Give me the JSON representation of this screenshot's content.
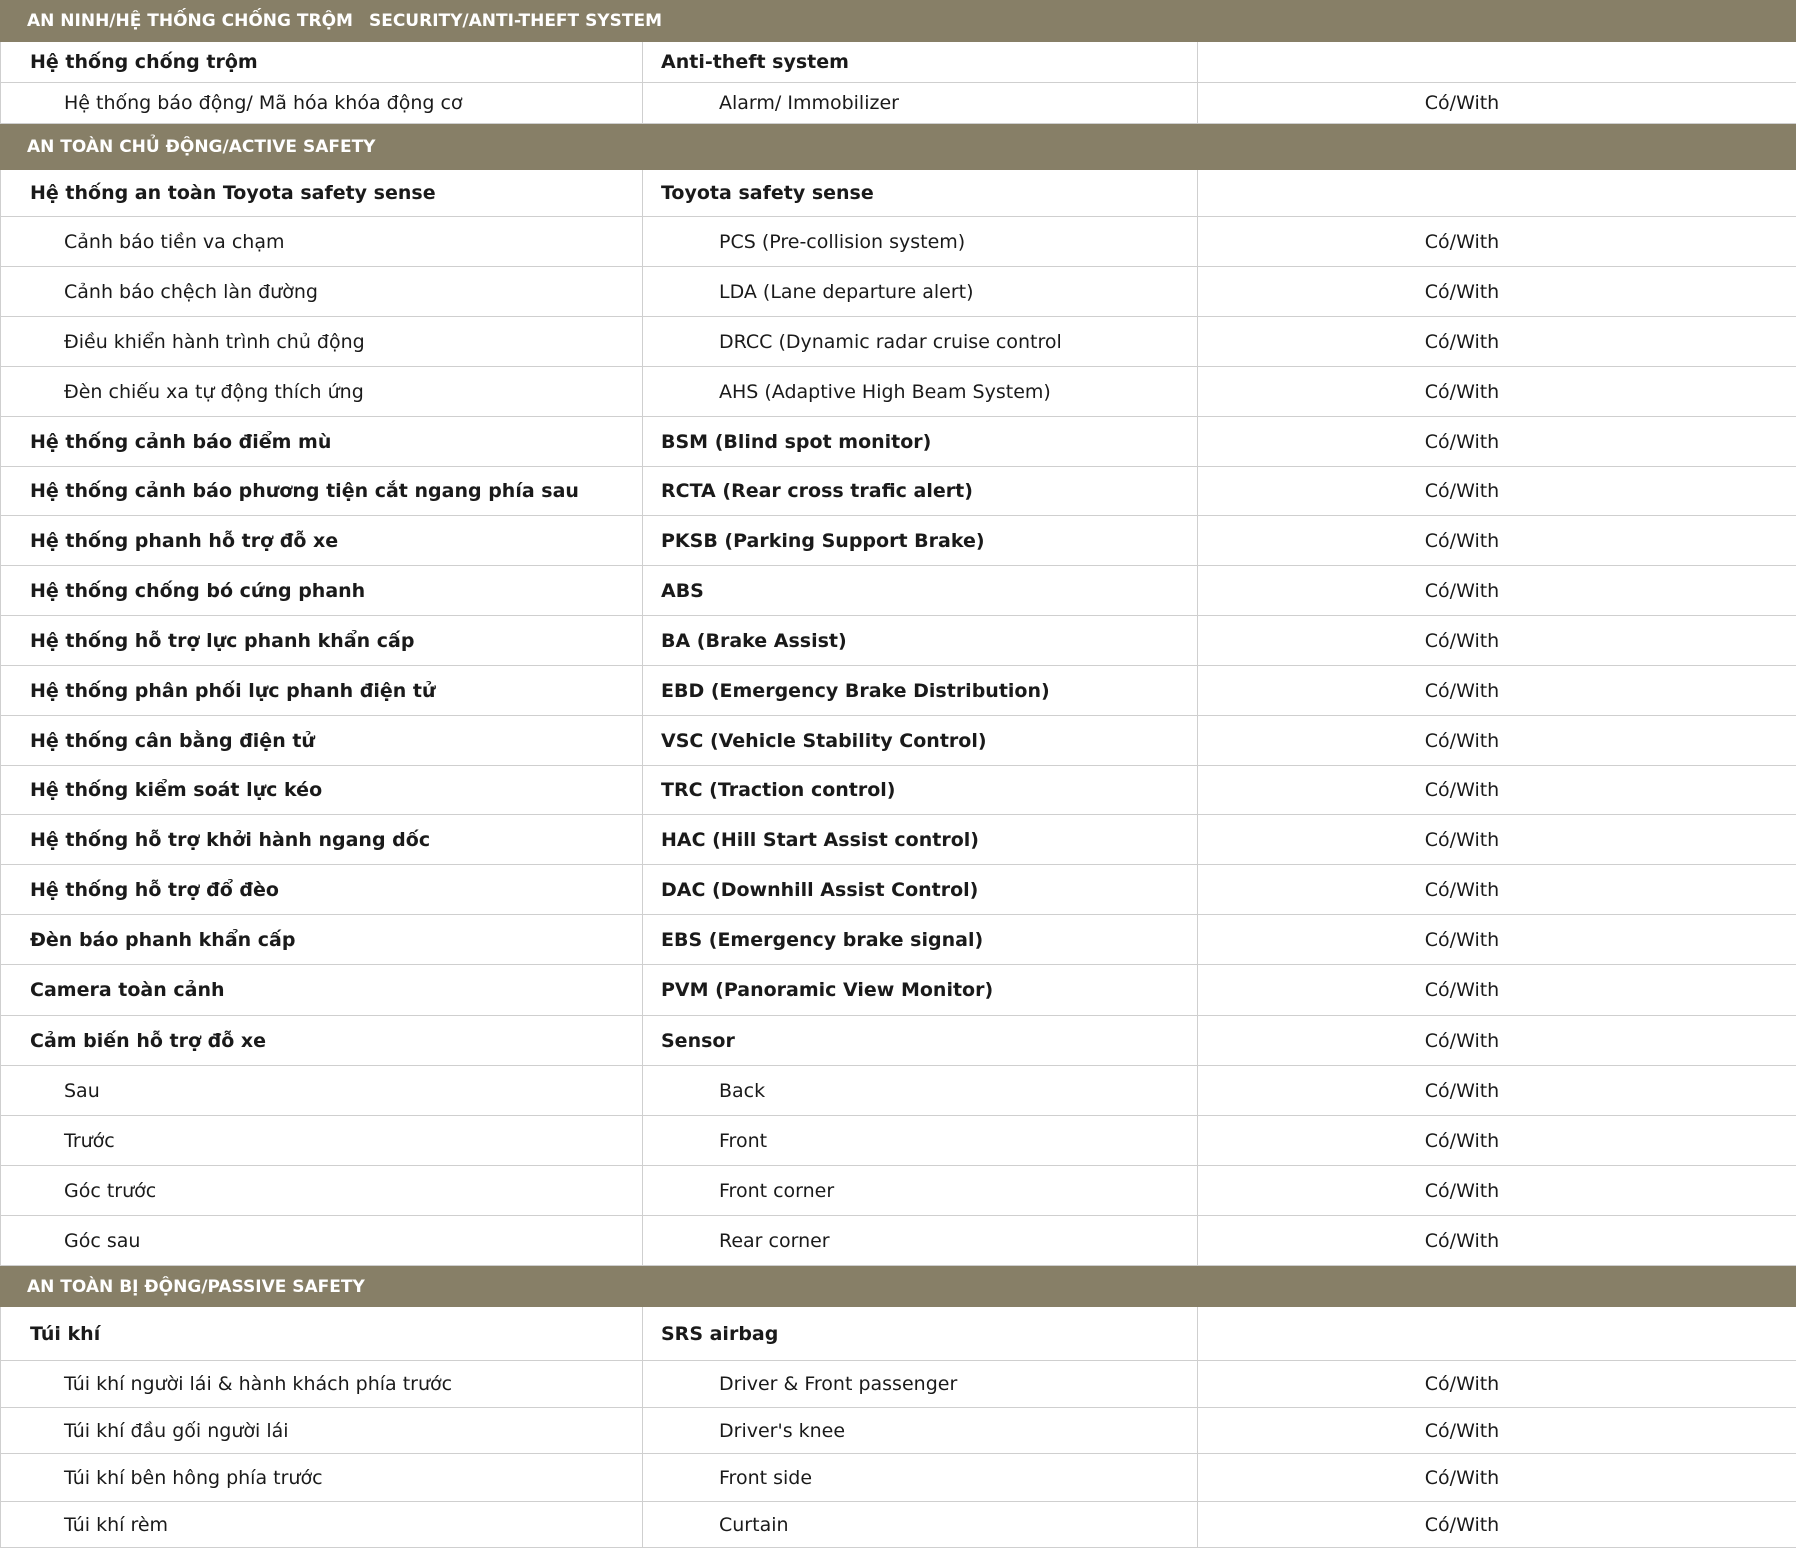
{
  "sections": [
    {
      "id": "security",
      "title_vi": "AN NINH/HỆ THỐNG CHỐNG TRỘM",
      "title_en": "SECURITY/ANTI-THEFT SYSTEM",
      "rows": [
        {
          "vi": "Hệ thống chống trộm",
          "en": "Anti-theft system",
          "value": "",
          "type": "main"
        },
        {
          "vi": "Hệ thống báo động/ Mã hóa khóa động cơ",
          "en": "Alarm/ Immobilizer",
          "value": "Có/With",
          "type": "sub"
        }
      ]
    },
    {
      "id": "active-safety",
      "title_vi": "AN TOÀN CHỦ ĐỘNG/ACTIVE SAFETY",
      "title_en": "",
      "rows": [
        {
          "vi": "Hệ thống an toàn Toyota safety sense",
          "en": "Toyota safety sense",
          "value": "",
          "type": "main"
        },
        {
          "vi": "Cảnh báo tiền va chạm",
          "en": "PCS (Pre-collision system)",
          "value": "Có/With",
          "type": "sub"
        },
        {
          "vi": "Cảnh báo chệch làn đường",
          "en": "LDA (Lane departure alert)",
          "value": "Có/With",
          "type": "sub"
        },
        {
          "vi": "Điều khiển hành trình chủ động",
          "en": "DRCC (Dynamic radar cruise control",
          "value": "Có/With",
          "type": "sub"
        },
        {
          "vi": "Đèn chiếu xa tự động thích ứng",
          "en": "AHS (Adaptive High Beam System)",
          "value": "Có/With",
          "type": "sub"
        },
        {
          "vi": "Hệ thống cảnh báo điểm mù",
          "en": "BSM (Blind spot monitor)",
          "value": "Có/With",
          "type": "main"
        },
        {
          "vi": "Hệ thống cảnh báo phương tiện cắt ngang phía sau",
          "en": "RCTA (Rear cross trafic alert)",
          "value": "Có/With",
          "type": "main"
        },
        {
          "vi": "Hệ thống phanh hỗ trợ đỗ xe",
          "en": "PKSB (Parking Support Brake)",
          "value": "Có/With",
          "type": "main"
        },
        {
          "vi": "Hệ thống chống bó cứng phanh",
          "en": "ABS",
          "value": "Có/With",
          "type": "main"
        },
        {
          "vi": "Hệ thống hỗ trợ lực phanh khẩn cấp",
          "en": "BA (Brake Assist)",
          "value": "Có/With",
          "type": "main"
        },
        {
          "vi": "Hệ thống phân phối lực phanh điện tử",
          "en": "EBD (Emergency Brake Distribution)",
          "value": "Có/With",
          "type": "main"
        },
        {
          "vi": "Hệ thống cân bằng điện tử",
          "en": "VSC (Vehicle Stability Control)",
          "value": "Có/With",
          "type": "main"
        },
        {
          "vi": "Hệ thống kiểm soát lực kéo",
          "en": "TRC (Traction control)",
          "value": "Có/With",
          "type": "main"
        },
        {
          "vi": "Hệ thống hỗ trợ khởi hành ngang dốc",
          "en": "HAC (Hill Start Assist control)",
          "value": "Có/With",
          "type": "main"
        },
        {
          "vi": "Hệ thống hỗ trợ đổ đèo",
          "en": "DAC (Downhill Assist Control)",
          "value": "Có/With",
          "type": "main"
        },
        {
          "vi": "Đèn báo phanh khẩn cấp",
          "en": "EBS (Emergency brake signal)",
          "value": "Có/With",
          "type": "main"
        },
        {
          "vi": "Camera toàn cảnh",
          "en": "PVM (Panoramic View Monitor)",
          "value": "Có/With",
          "type": "main"
        },
        {
          "vi": "Cảm biến hỗ trợ đỗ xe",
          "en": "Sensor",
          "value": "Có/With",
          "type": "main"
        },
        {
          "vi": "Sau",
          "en": "Back",
          "value": "Có/With",
          "type": "sub"
        },
        {
          "vi": "Trước",
          "en": "Front",
          "value": "Có/With",
          "type": "sub"
        },
        {
          "vi": "Góc trước",
          "en": "Front corner",
          "value": "Có/With",
          "type": "sub"
        },
        {
          "vi": "Góc sau",
          "en": "Rear corner",
          "value": "Có/With",
          "type": "sub"
        }
      ]
    },
    {
      "id": "passive-safety",
      "title_vi": "AN TOÀN BỊ ĐỘNG/PASSIVE SAFETY",
      "title_en": "",
      "rows": [
        {
          "vi": "Túi khí",
          "en": "SRS airbag",
          "value": "",
          "type": "main"
        },
        {
          "vi": "Túi khí người lái & hành khách phía trước",
          "en": "Driver & Front passenger",
          "value": "Có/With",
          "type": "sub"
        },
        {
          "vi": "Túi khí đầu gối người lái",
          "en": "Driver's knee",
          "value": "Có/With",
          "type": "sub"
        },
        {
          "vi": "Túi khí bên hông phía trước",
          "en": "Front side",
          "value": "Có/With",
          "type": "sub"
        },
        {
          "vi": "Túi khí rèm",
          "en": "Curtain",
          "value": "Có/With",
          "type": "sub"
        }
      ]
    }
  ]
}
